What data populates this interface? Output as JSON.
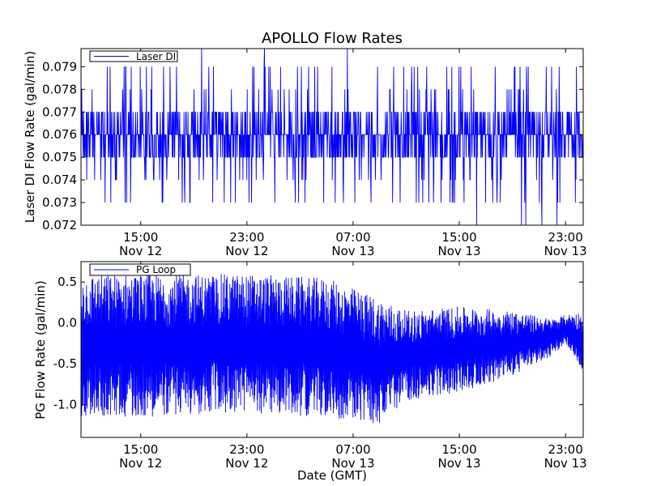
{
  "chart_data": [
    {
      "type": "line",
      "title": "APOLLO Flow Rates",
      "xlabel": "",
      "ylabel": "Laser DI Flow Rate (gal/min)",
      "ylim": [
        0.072,
        0.0798
      ],
      "yticks": [
        "0.072",
        "0.073",
        "0.074",
        "0.075",
        "0.076",
        "0.077",
        "0.078",
        "0.079"
      ],
      "ytick_values": [
        0.072,
        0.073,
        0.074,
        0.075,
        0.076,
        0.077,
        0.078,
        0.079
      ],
      "x_start": "Nov 12 10:30",
      "x_end": "Nov 14 00:20",
      "x_tick_labels": [
        {
          "time": "15:00",
          "date": "Nov 12"
        },
        {
          "time": "23:00",
          "date": "Nov 12"
        },
        {
          "time": "07:00",
          "date": "Nov 13"
        },
        {
          "time": "15:00",
          "date": "Nov 13"
        },
        {
          "time": "23:00",
          "date": "Nov 13"
        }
      ],
      "legend": "top-left",
      "color": "#0000ff",
      "series": [
        {
          "name": "Laser DI",
          "baseline": 0.076,
          "typical_range": [
            0.075,
            0.077
          ],
          "levels": [
            0.072,
            0.073,
            0.074,
            0.075,
            0.076,
            0.077,
            0.078,
            0.079,
            0.08
          ]
        }
      ]
    },
    {
      "type": "line",
      "title": "",
      "xlabel": "Date (GMT)",
      "ylabel": "PG Flow Rate (gal/min)",
      "ylim": [
        -1.4,
        0.75
      ],
      "yticks": [
        "-1.0",
        "-0.5",
        "0.0",
        "0.5"
      ],
      "ytick_values": [
        -1.0,
        -0.5,
        0.0,
        0.5
      ],
      "x_start": "Nov 12 10:30",
      "x_end": "Nov 14 00:20",
      "x_tick_labels": [
        {
          "time": "15:00",
          "date": "Nov 12"
        },
        {
          "time": "23:00",
          "date": "Nov 12"
        },
        {
          "time": "07:00",
          "date": "Nov 13"
        },
        {
          "time": "15:00",
          "date": "Nov 13"
        },
        {
          "time": "23:00",
          "date": "Nov 13"
        }
      ],
      "legend": "top-left",
      "color": "#0000ff",
      "series": [
        {
          "name": "PG Loop",
          "envelope": [
            {
              "t": "Nov 12 10:30",
              "max": 0.6,
              "min": -1.15
            },
            {
              "t": "Nov 12 15:00",
              "max": 0.6,
              "min": -1.15
            },
            {
              "t": "Nov 12 23:00",
              "max": 0.6,
              "min": -1.1
            },
            {
              "t": "Nov 13 05:00",
              "max": 0.55,
              "min": -1.15
            },
            {
              "t": "Nov 13 09:00",
              "max": 0.3,
              "min": -1.25
            },
            {
              "t": "Nov 13 11:00",
              "max": 0.15,
              "min": -0.95
            },
            {
              "t": "Nov 13 15:00",
              "max": 0.2,
              "min": -0.85
            },
            {
              "t": "Nov 13 19:00",
              "max": 0.15,
              "min": -0.65
            },
            {
              "t": "Nov 13 22:00",
              "max": 0.05,
              "min": -0.4
            },
            {
              "t": "Nov 13 23:00",
              "max": 0.1,
              "min": -0.25
            },
            {
              "t": "Nov 14 00:20",
              "max": 0.15,
              "min": -0.6
            }
          ]
        }
      ]
    }
  ]
}
